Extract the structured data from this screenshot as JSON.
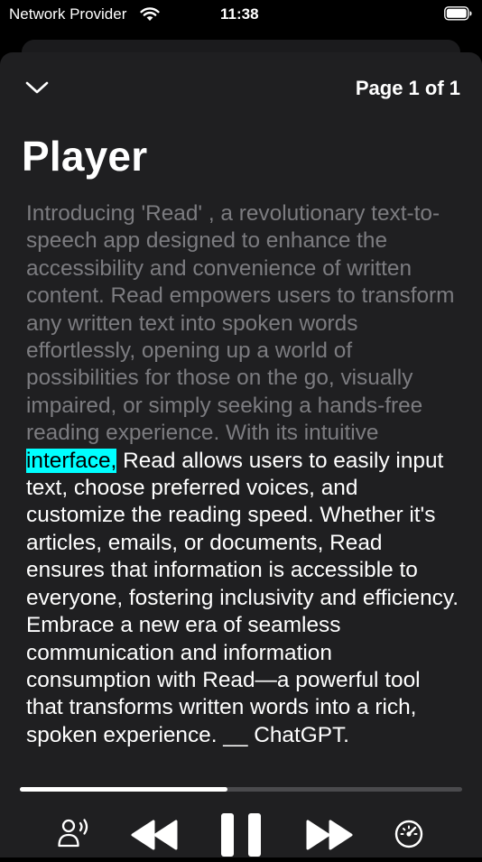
{
  "status_bar": {
    "carrier": "Network Provider",
    "time": "11:38",
    "wifi_icon": "wifi-icon",
    "battery_icon": "battery-icon"
  },
  "header": {
    "collapse_icon": "chevron-down-icon",
    "page_indicator": "Page 1 of 1"
  },
  "title": "Player",
  "content": {
    "read_text": "Introducing 'Read' , a revolutionary text-to- speech app designed to enhance the accessibility and convenience of written content. Read empowers users to transform any written text into spoken words effortlessly, opening up a world of possibilities for those on the go, visually impaired, or simply seeking a hands-free reading experience. With its intuitive ",
    "current_word": "interface,",
    "upcoming_text": " Read allows users to easily input text, choose preferred voices, and customize the reading speed. Whether it's articles, emails, or documents, Read ensures that information is accessible to everyone, fostering inclusivity and efficiency. Embrace a new era of seamless communication and information consumption with Read—a powerful tool that transforms written words into a rich, spoken experience. __ ChatGPT."
  },
  "player": {
    "progress": 0.47,
    "controls": {
      "voice": "voice-icon",
      "rewind": "rewind-icon",
      "pause": "pause-icon",
      "fast_forward": "fast-forward-icon",
      "speed": "speed-gauge-icon"
    }
  },
  "colors": {
    "background": "#000000",
    "sheet": "#1f1f21",
    "read_text": "#7c7c80",
    "highlight": "#00ffff",
    "progress_fill": "#ffffff",
    "progress_track": "#4a4a4d"
  }
}
